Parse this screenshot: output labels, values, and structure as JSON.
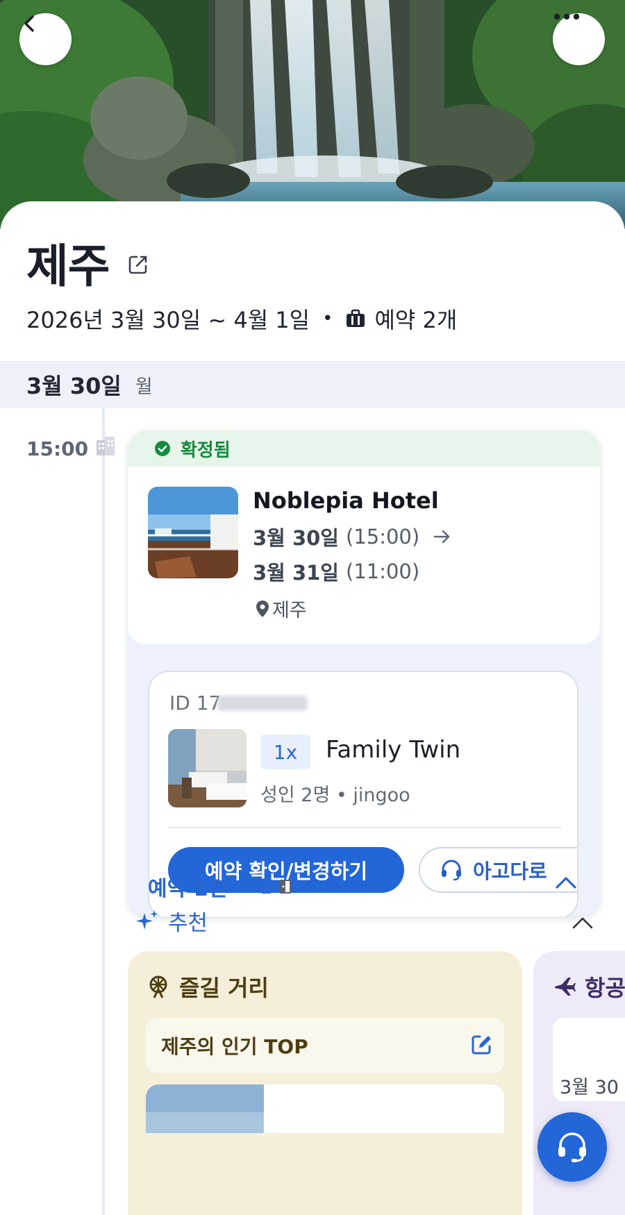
{
  "header": {
    "back_icon": "chevron-left-icon",
    "more_icon": "more-horizontal-icon",
    "hero_image": "waterfall photo"
  },
  "trip": {
    "title": "제주",
    "edit_icon": "edit-icon",
    "dates": "2026년 3월 30일 ~ 4월 1일",
    "separator": "•",
    "bag_icon": "briefcase-icon",
    "booking_count": "예약 2개"
  },
  "day": {
    "date": "3월 30일",
    "weekday": "월"
  },
  "timeline": {
    "time": "15:00",
    "type_icon": "building-icon"
  },
  "booking": {
    "status": "확정됨",
    "status_color": "#168b3e",
    "hotel_name": "Noblepia Hotel",
    "checkin_date": "3월 30일",
    "checkin_time": "(15:00)",
    "checkout_date": "3월 31일",
    "checkout_time": "(11:00)",
    "location": "제주",
    "room": {
      "id_label": "ID 17",
      "quantity": "1x",
      "name": "Family Twin",
      "guests": "성인 2명 • jingoo",
      "manage_label": "예약 확인/변경하기",
      "support_label": "아고다로"
    },
    "count_label": "예약 1건",
    "count_separator": "•",
    "room_count": "1"
  },
  "recommend": {
    "label": "추천",
    "cards": [
      {
        "title": "즐길 거리",
        "subtitle": "제주의 인기 TOP"
      },
      {
        "title": "항공",
        "date": "3월 30"
      }
    ]
  },
  "colors": {
    "accent": "#2266d8",
    "day_bar": "#eef1fa",
    "status_bg": "#e6f5ea",
    "fun_card": "#f5efd9",
    "flight_card": "#efeaf8"
  }
}
